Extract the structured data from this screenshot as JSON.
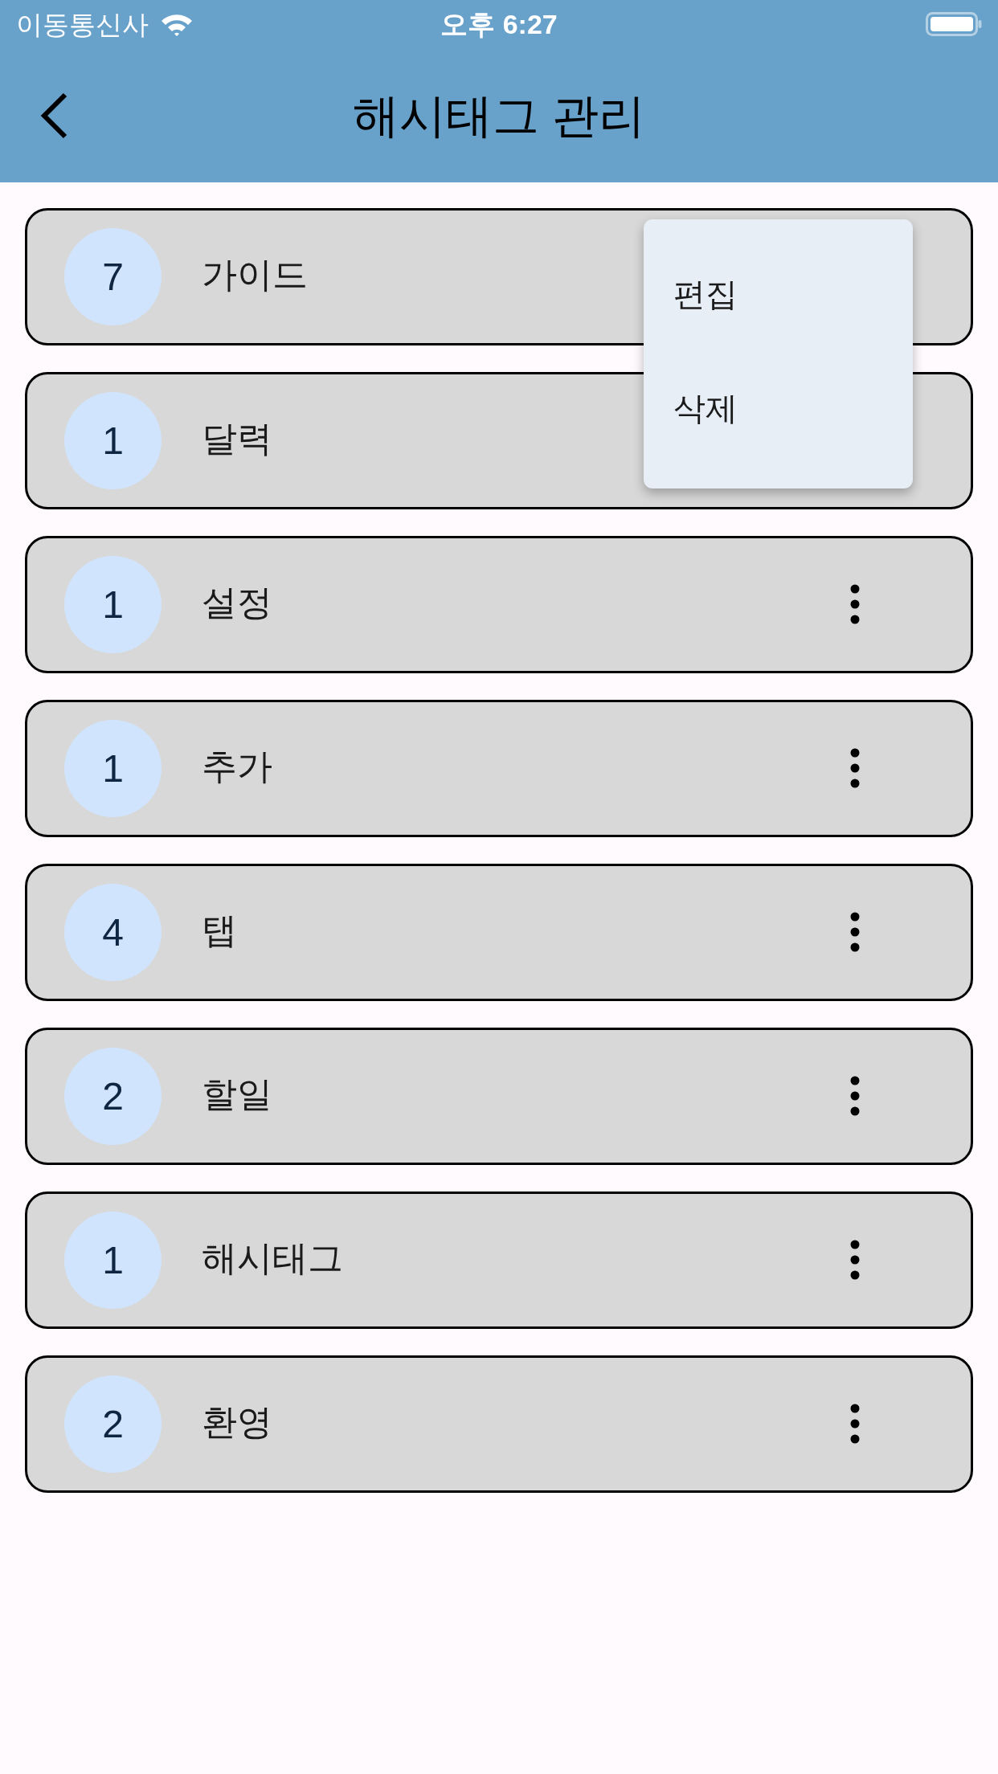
{
  "status_bar": {
    "carrier": "이동통신사",
    "time": "오후 6:27"
  },
  "header": {
    "title": "해시태그 관리"
  },
  "menu_items": [
    "편집",
    "삭제"
  ],
  "hashtags": [
    {
      "count": "7",
      "name": "가이드",
      "menu_open": true
    },
    {
      "count": "1",
      "name": "달력",
      "menu_open": false
    },
    {
      "count": "1",
      "name": "설정",
      "menu_open": false
    },
    {
      "count": "1",
      "name": "추가",
      "menu_open": false
    },
    {
      "count": "4",
      "name": "탭",
      "menu_open": false
    },
    {
      "count": "2",
      "name": "할일",
      "menu_open": false
    },
    {
      "count": "1",
      "name": "해시태그",
      "menu_open": false
    },
    {
      "count": "2",
      "name": "환영",
      "menu_open": false
    }
  ]
}
